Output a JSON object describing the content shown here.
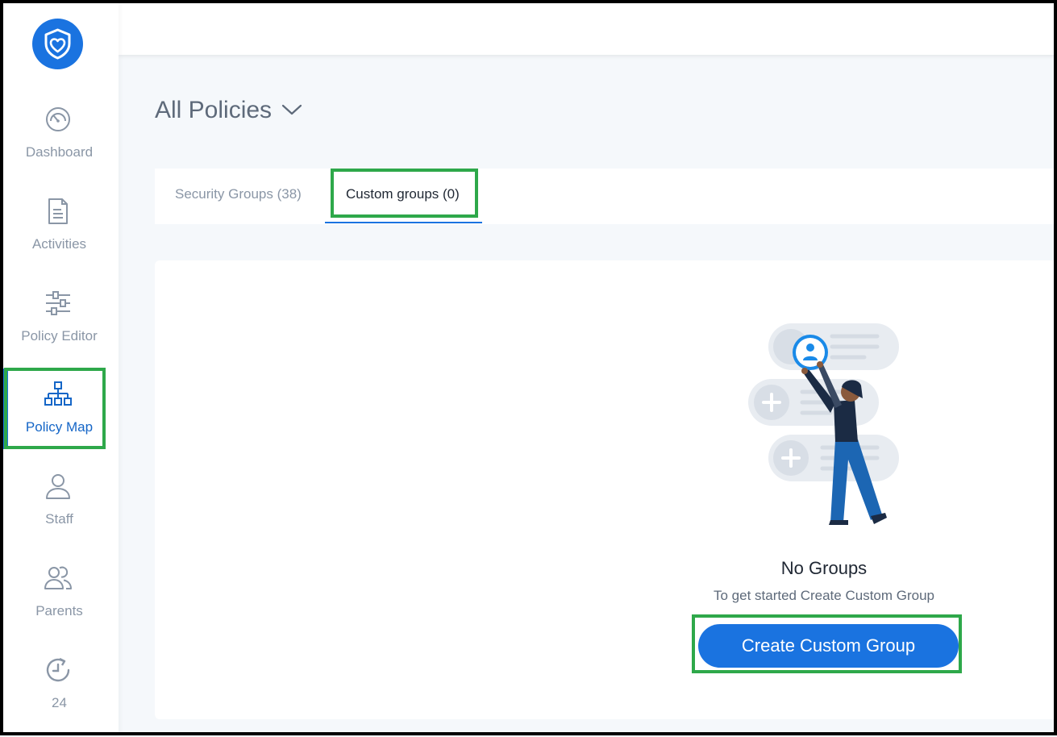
{
  "sidebar": {
    "logo_icon": "shield-heart-icon",
    "items": [
      {
        "label": "Dashboard",
        "icon": "speedometer-icon",
        "active": false
      },
      {
        "label": "Activities",
        "icon": "document-icon",
        "active": false
      },
      {
        "label": "Policy Editor",
        "icon": "sliders-icon",
        "active": false
      },
      {
        "label": "Policy Map",
        "icon": "hierarchy-icon",
        "active": true
      },
      {
        "label": "Staff",
        "icon": "user-icon",
        "active": false
      },
      {
        "label": "Parents",
        "icon": "users-icon",
        "active": false
      },
      {
        "label": "24",
        "icon": "history-clock-icon",
        "active": false
      }
    ]
  },
  "header": {
    "title": "All Policies",
    "title_icon": "chevron-down-icon"
  },
  "tabs": [
    {
      "label": "Security Groups (38)",
      "active": false
    },
    {
      "label": "Custom groups (0)",
      "active": true
    }
  ],
  "empty_state": {
    "illustration": "person-adding-group-illustration",
    "title": "No Groups",
    "subtitle": "To get started Create Custom Group",
    "button_label": "Create Custom Group"
  },
  "colors": {
    "accent": "#1a73e0",
    "highlight": "#2ea84a",
    "text_muted": "#8a96a6",
    "background": "#f5f8fb"
  }
}
